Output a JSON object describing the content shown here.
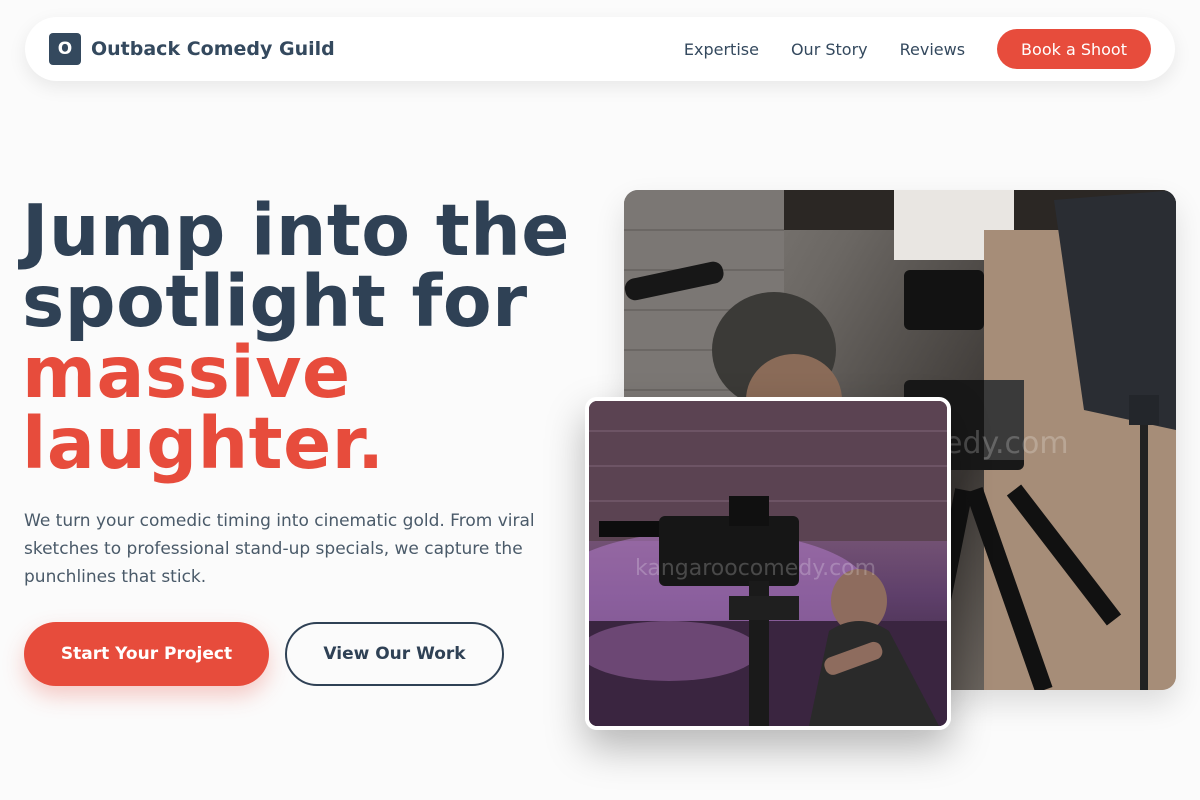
{
  "nav": {
    "brand_initial": "O",
    "brand_name": "Outback Comedy Guild",
    "links": [
      "Expertise",
      "Our Story",
      "Reviews"
    ],
    "cta": "Book a Shoot"
  },
  "hero": {
    "title_line1": "Jump into the",
    "title_line2": "spotlight for",
    "title_accent_line1": "massive",
    "title_accent_line2": "laughter.",
    "description": "We turn your comedic timing into cinematic gold. From viral sketches to professional stand-up specials, we capture the punchlines that stick.",
    "primary_button": "Start Your Project",
    "secondary_button": "View Our Work"
  },
  "images": {
    "large_watermark": "edy.com",
    "small_watermark": "kangaroocomedy.com"
  },
  "colors": {
    "accent": "#e74c3c",
    "primary_text": "#2f4155",
    "background": "#fbfbfb"
  }
}
